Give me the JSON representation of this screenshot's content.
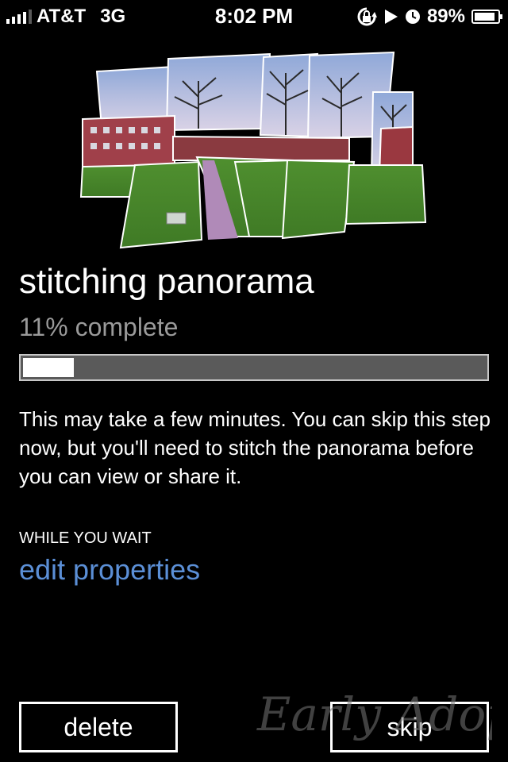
{
  "status_bar": {
    "carrier": "AT&T",
    "network": "3G",
    "time": "8:02 PM",
    "battery": "89%",
    "battery_level": 0.89,
    "icons": [
      "signal-bars-icon",
      "rotation-lock-icon",
      "play-icon",
      "clock-icon",
      "battery-icon"
    ]
  },
  "main": {
    "title": "stitching panorama",
    "progress_text": "11% complete",
    "progress": 0.11,
    "description": "This may take a few minutes. You can skip this step now, but you'll need to stitch the panorama before you can view or share it.",
    "section_label": "WHILE YOU WAIT",
    "link_label": "edit properties"
  },
  "buttons": {
    "delete_label": "delete",
    "skip_label": "skip"
  },
  "watermark": {
    "text": "Early Adopter"
  },
  "colors": {
    "background": "#000000",
    "link": "#5b8fd6",
    "progress_track": "#5a5a5a",
    "subtitle": "#9a9a9a"
  }
}
